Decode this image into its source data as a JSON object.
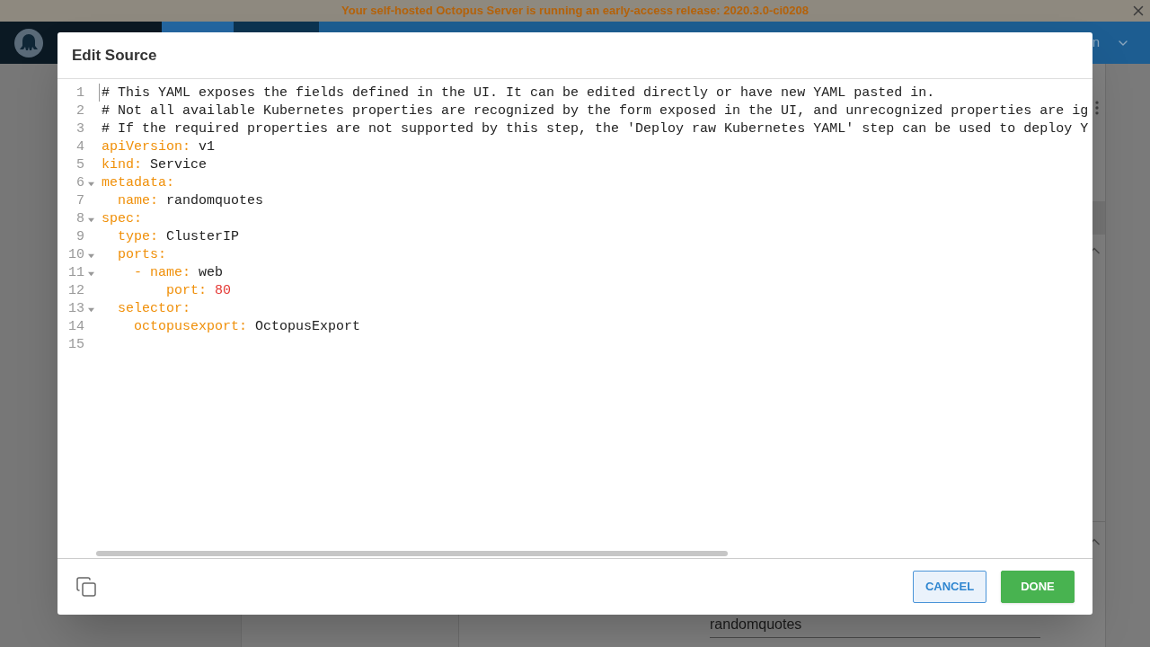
{
  "banner": {
    "text": "Your self-hosted Octopus Server is running an early-access release: 2020.3.0-ci0208"
  },
  "header": {
    "user_fragment": "n"
  },
  "background_field": {
    "value": "randomquotes"
  },
  "dialog": {
    "title": "Edit Source",
    "lines": [
      {
        "number": "1",
        "kind": "comment",
        "text": "# This YAML exposes the fields defined in the UI. It can be edited directly or have new YAML pasted in."
      },
      {
        "number": "2",
        "kind": "comment",
        "text": "# Not all available Kubernetes properties are recognized by the form exposed in the UI, and unrecognized properties are ig"
      },
      {
        "number": "3",
        "kind": "comment",
        "text": "# If the required properties are not supported by this step, the 'Deploy raw Kubernetes YAML' step can be used to deploy Y"
      },
      {
        "number": "4",
        "kind": "pair",
        "key": "apiVersion:",
        "value": "v1"
      },
      {
        "number": "5",
        "kind": "pair",
        "key": "kind:",
        "value": "Service"
      },
      {
        "number": "6",
        "kind": "pair",
        "key": "metadata:",
        "expanded": true,
        "children": [
          {
            "number": "7",
            "kind": "pair",
            "key": "name:",
            "value": "randomquotes"
          }
        ]
      },
      {
        "number": "8",
        "kind": "pair",
        "key": "spec:",
        "expanded": true,
        "children": [
          {
            "number": "9",
            "kind": "pair",
            "key": "type:",
            "value": "ClusterIP"
          },
          {
            "number": "10",
            "kind": "pair",
            "key": "ports:",
            "expanded": true,
            "children": [
              {
                "number": "11",
                "kind": "list-item",
                "dash": "-",
                "key": "name:",
                "value": "web",
                "expanded": true,
                "children": [
                  {
                    "number": "12",
                    "kind": "number-pair",
                    "key": "port:",
                    "value": "80"
                  }
                ]
              }
            ]
          },
          {
            "number": "13",
            "kind": "pair",
            "key": "selector:",
            "expanded": true,
            "children": [
              {
                "number": "14",
                "kind": "pair",
                "key": "octopusexport:",
                "value": "OctopusExport"
              }
            ]
          }
        ]
      },
      {
        "number": "15",
        "kind": "blank"
      }
    ],
    "buttons": [
      {
        "label": "CANCEL",
        "kind": "secondary"
      },
      {
        "label": "DONE",
        "kind": "primary"
      }
    ]
  }
}
